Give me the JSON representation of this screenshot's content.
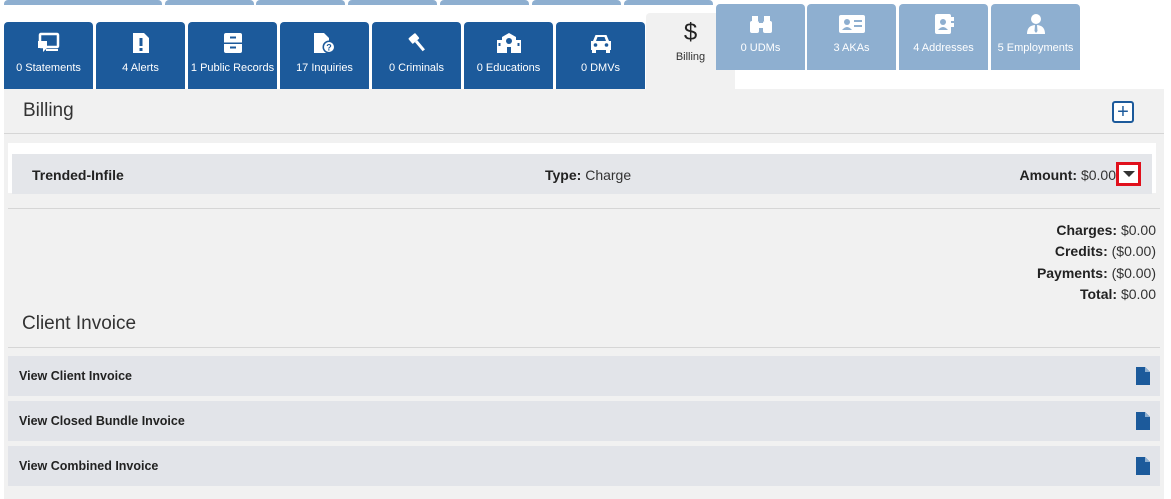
{
  "tabs_front": [
    {
      "label": "0 Statements",
      "icon": "monitor-chat-icon"
    },
    {
      "label": "4 Alerts",
      "icon": "alert-file-icon"
    },
    {
      "label": "1 Public Records",
      "icon": "file-cabinet-icon"
    },
    {
      "label": "17 Inquiries",
      "icon": "question-file-icon"
    },
    {
      "label": "0 Criminals",
      "icon": "gavel-icon"
    },
    {
      "label": "0 Educations",
      "icon": "school-icon"
    },
    {
      "label": "0 DMVs",
      "icon": "car-icon"
    }
  ],
  "active_tab": {
    "label": "Billing",
    "icon": "dollar-icon",
    "symbol": "$"
  },
  "tabs_right": [
    {
      "label": "0 UDMs",
      "icon": "binoculars-icon"
    },
    {
      "label": "3 AKAs",
      "icon": "id-card-icon"
    },
    {
      "label": "4 Addresses",
      "icon": "address-book-icon"
    },
    {
      "label": "5 Employments",
      "icon": "user-tie-icon"
    }
  ],
  "billing": {
    "title": "Billing",
    "add_symbol": "+",
    "item": {
      "name": "Trended-Infile",
      "type_label": "Type:",
      "type_value": "Charge",
      "amount_label": "Amount:",
      "amount_value": "$0.00"
    },
    "totals": [
      {
        "label": "Charges:",
        "value": "$0.00"
      },
      {
        "label": "Credits:",
        "value": "($0.00)"
      },
      {
        "label": "Payments:",
        "value": "($0.00)"
      },
      {
        "label": "Total:",
        "value": "$0.00"
      }
    ]
  },
  "client_invoice": {
    "title": "Client Invoice",
    "rows": [
      {
        "label": "View Client Invoice",
        "icon": "document-icon"
      },
      {
        "label": "View Closed Bundle Invoice",
        "icon": "document-icon"
      },
      {
        "label": "View Combined Invoice",
        "icon": "document-icon"
      }
    ]
  },
  "colors": {
    "primary": "#1c5a9b",
    "light_tab": "#8eafd0",
    "highlight": "#e0101c",
    "panel_bg": "#f1f1f1"
  }
}
